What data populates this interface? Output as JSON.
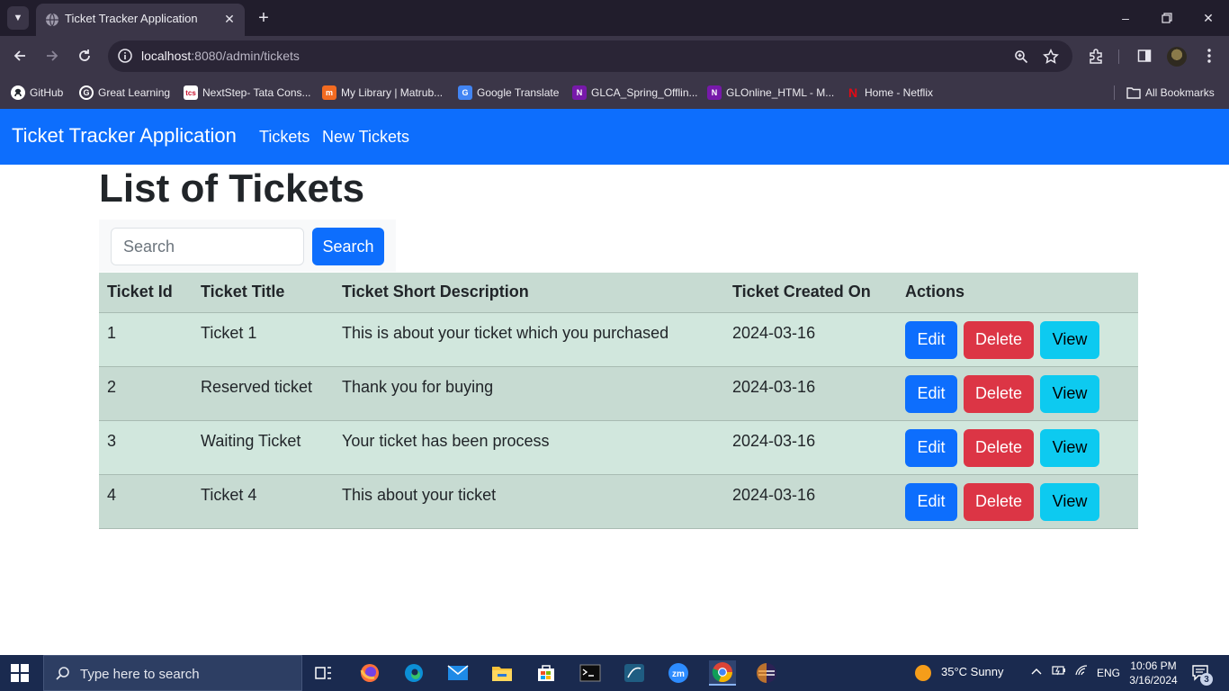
{
  "browser": {
    "tab_title": "Ticket Tracker Application",
    "url_host": "localhost",
    "url_path": ":8080/admin/tickets",
    "bookmarks": [
      {
        "label": "GitHub",
        "icon": "github-icon"
      },
      {
        "label": "Great Learning",
        "icon": "great-learning-icon"
      },
      {
        "label": "NextStep- Tata Cons...",
        "icon": "tcs-icon"
      },
      {
        "label": "My Library | Matrub...",
        "icon": "matrubharti-icon"
      },
      {
        "label": "Google Translate",
        "icon": "google-translate-icon"
      },
      {
        "label": "GLCA_Spring_Offlin...",
        "icon": "onenote-icon"
      },
      {
        "label": "GLOnline_HTML - M...",
        "icon": "onenote-icon"
      },
      {
        "label": "Home - Netflix",
        "icon": "netflix-icon"
      }
    ],
    "all_bookmarks_label": "All Bookmarks"
  },
  "app": {
    "brand": "Ticket Tracker Application",
    "nav": [
      "Tickets",
      "New Tickets"
    ],
    "page_title": "List of Tickets",
    "search": {
      "placeholder": "Search",
      "button_label": "Search"
    },
    "table": {
      "headers": [
        "Ticket Id",
        "Ticket Title",
        "Ticket Short Description",
        "Ticket Created On",
        "Actions"
      ],
      "rows": [
        {
          "id": "1",
          "title": "Ticket 1",
          "description": "This is about your ticket which you purchased",
          "created_on": "2024-03-16"
        },
        {
          "id": "2",
          "title": "Reserved ticket",
          "description": "Thank you for buying",
          "created_on": "2024-03-16"
        },
        {
          "id": "3",
          "title": "Waiting Ticket",
          "description": "Your ticket has been process",
          "created_on": "2024-03-16"
        },
        {
          "id": "4",
          "title": "Ticket 4",
          "description": "This about your ticket",
          "created_on": "2024-03-16"
        }
      ],
      "actions": {
        "edit": "Edit",
        "delete": "Delete",
        "view": "View"
      }
    },
    "colors": {
      "navbar": "#0d6efd",
      "edit": "#0d6efd",
      "delete": "#dc3545",
      "view": "#0dcaf0",
      "row": "#d1e7dd"
    }
  },
  "taskbar": {
    "search_placeholder": "Type here to search",
    "weather": "35°C  Sunny",
    "language": "ENG",
    "time": "10:06 PM",
    "date": "3/16/2024",
    "notification_count": "3"
  }
}
